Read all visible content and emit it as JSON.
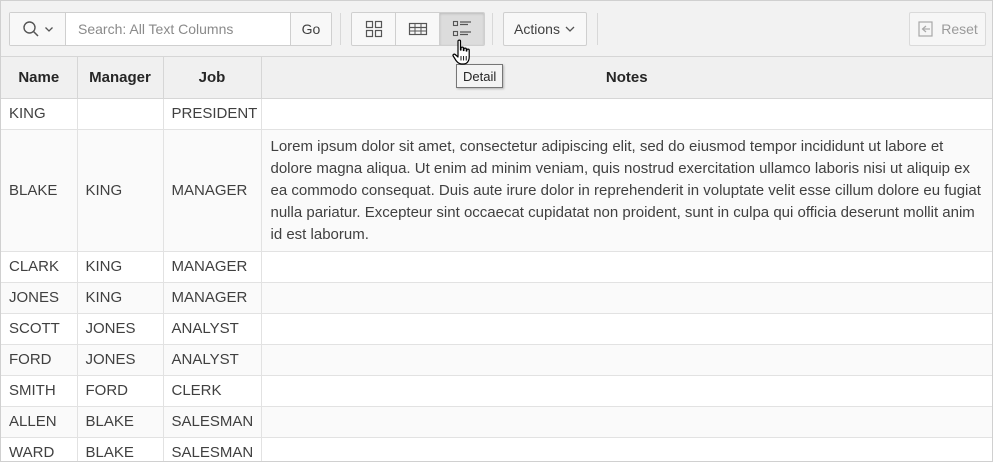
{
  "toolbar": {
    "search_placeholder": "Search: All Text Columns",
    "search_icon": "magnifier-icon",
    "go_label": "Go",
    "view_buttons": [
      {
        "name": "icon-view",
        "icon": "grid-icon"
      },
      {
        "name": "report-view",
        "icon": "table-icon"
      },
      {
        "name": "detail-view",
        "icon": "detail-list-icon",
        "active": true
      }
    ],
    "actions_label": "Actions",
    "reset_label": "Reset"
  },
  "tooltip": "Detail",
  "table": {
    "columns": [
      "Name",
      "Manager",
      "Job",
      "Notes"
    ],
    "rows": [
      {
        "name": "KING",
        "manager": "",
        "job": "PRESIDENT",
        "notes": ""
      },
      {
        "name": "BLAKE",
        "manager": "KING",
        "job": "MANAGER",
        "notes": "Lorem ipsum dolor sit amet, consectetur adipiscing elit, sed do eiusmod tempor incididunt ut labore et dolore magna aliqua. Ut enim ad minim veniam, quis nostrud exercitation ullamco laboris nisi ut aliquip ex ea commodo consequat. Duis aute irure dolor in reprehenderit in voluptate velit esse cillum dolore eu fugiat nulla pariatur. Excepteur sint occaecat cupidatat non proident, sunt in culpa qui officia deserunt mollit anim id est laborum."
      },
      {
        "name": "CLARK",
        "manager": "KING",
        "job": "MANAGER",
        "notes": ""
      },
      {
        "name": "JONES",
        "manager": "KING",
        "job": "MANAGER",
        "notes": ""
      },
      {
        "name": "SCOTT",
        "manager": "JONES",
        "job": "ANALYST",
        "notes": ""
      },
      {
        "name": "FORD",
        "manager": "JONES",
        "job": "ANALYST",
        "notes": ""
      },
      {
        "name": "SMITH",
        "manager": "FORD",
        "job": "CLERK",
        "notes": ""
      },
      {
        "name": "ALLEN",
        "manager": "BLAKE",
        "job": "SALESMAN",
        "notes": ""
      },
      {
        "name": "WARD",
        "manager": "BLAKE",
        "job": "SALESMAN",
        "notes": ""
      }
    ]
  }
}
